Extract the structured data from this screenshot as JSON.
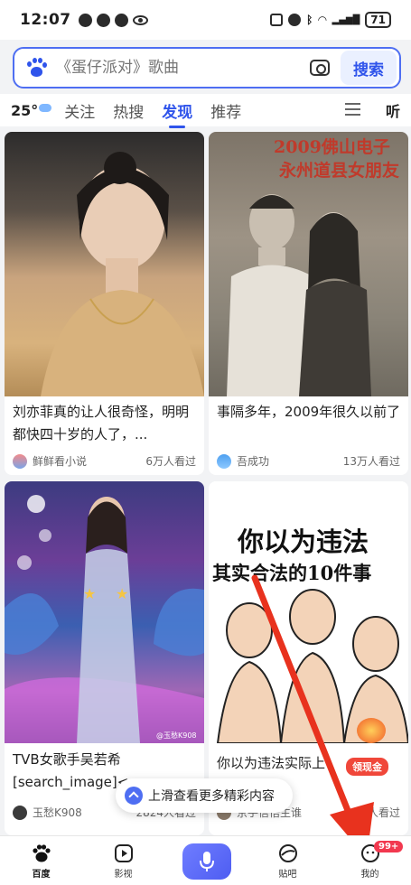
{
  "status_bar": {
    "time": "12:07",
    "battery": "71"
  },
  "search": {
    "placeholder": "《蛋仔派对》歌曲",
    "button_label": "搜索"
  },
  "tabs": {
    "weather": "25°",
    "items": [
      {
        "label": "关注"
      },
      {
        "label": "热搜"
      },
      {
        "label": "发现",
        "active": true
      },
      {
        "label": "推荐"
      }
    ],
    "listen_label": "听"
  },
  "feed": [
    {
      "title": "刘亦菲真的让人很奇怪，明明都快四十岁的人了，...",
      "author": "鲜鲜看小说",
      "views": "6万人看过"
    },
    {
      "title": "事隔多年，2009年很久以前了",
      "author": "吾成功",
      "views": "13万人看过",
      "image_text": [
        "2009佛山电子",
        "永州道县女朋友"
      ]
    },
    {
      "title": "TVB女歌手吴若希[search_image]<",
      "author": "玉愁K908",
      "views": "2824人看过",
      "image_watermark": "@玉愁K908"
    },
    {
      "title": "你以为违法实际上合法的",
      "author": "京手信悟主谁",
      "views": "万人看过",
      "image_text": [
        "你以为违法",
        "其实合法的10件事"
      ],
      "promo_label": "领现金"
    }
  ],
  "toast": {
    "label": "上滑查看更多精彩内容"
  },
  "bottom_nav": [
    {
      "label": "百度",
      "icon": "baidu-paw-icon"
    },
    {
      "label": "影视",
      "icon": "play-icon"
    },
    {
      "label": "",
      "icon": "microphone-icon"
    },
    {
      "label": "贴吧",
      "icon": "tieba-icon"
    },
    {
      "label": "我的",
      "icon": "profile-icon",
      "badge": "99+"
    }
  ],
  "colors": {
    "accent": "#2f54eb",
    "annotation_arrow": "#e8321e",
    "badge": "#f2384f"
  }
}
